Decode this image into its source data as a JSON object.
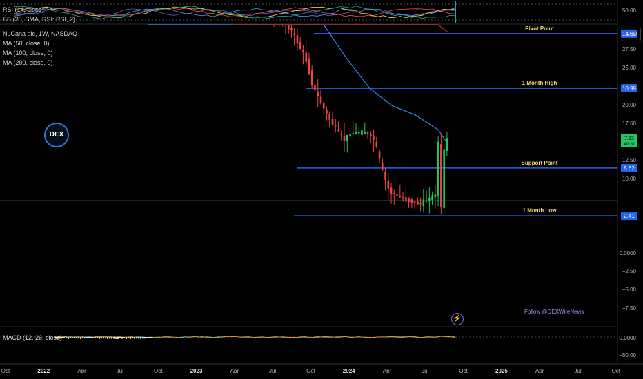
{
  "indicators": {
    "rsi_label": "RSI (14, close)",
    "bb_label": "BB (20, SMA, RSI: RSI, 2)",
    "ma50_label": "MA (50, close, 0)",
    "ma100_label": "MA (100, close, 0)",
    "ma200_label": "MA (200, close, 0)",
    "macd_label": "MACD (12, 26, close)"
  },
  "header": {
    "symbol_title": "NuCana plc, 1W, NASDAQ"
  },
  "currency_button": "USD",
  "logo_text": "DEX",
  "watermark": "Follow @DEXWireNews",
  "colors": {
    "up": "#22c55e",
    "down": "#ef4444",
    "level_line": "#2563eb",
    "ma_blue": "#3b82f6",
    "ma_red": "#dc2626",
    "label_gold": "#f5d76e",
    "current_price_bg": "#22c55e"
  },
  "chart_data": {
    "type": "candlestick",
    "title": "NuCana plc, 1W, NASDAQ",
    "currency": "USD",
    "x_tick_labels": [
      "Oct",
      "2022",
      "Apr",
      "Jul",
      "Oct",
      "2023",
      "Apr",
      "Jul",
      "Oct",
      "2024",
      "Apr",
      "Jul",
      "Oct",
      "2025",
      "Apr",
      "Jul",
      "Oct"
    ],
    "y_tick_labels": [
      "27.50",
      "25.00",
      "22.50",
      "20.00",
      "17.50",
      "12.50",
      "10.00",
      "0.0000",
      "−2.50",
      "−5.00",
      "−7.50"
    ],
    "ylim": [
      -10,
      30
    ],
    "levels": [
      {
        "name": "Pivot Point",
        "value": 14.67,
        "label": "14.67"
      },
      {
        "name": "1 Month High",
        "value": 10.99,
        "label": "10.99"
      },
      {
        "name": "Support Point",
        "value": 5.62,
        "label": "5.62"
      },
      {
        "name": "1 Month Low",
        "value": 2.41,
        "label": "2.41"
      }
    ],
    "current_price": 7.52,
    "current_price_label": "7.53",
    "current_price_sub": "40 20",
    "rsi_axis_label": "50.00",
    "macd_axis_labels": [
      "0.0000",
      "−50.00"
    ],
    "price_path": [
      [
        -1.0,
        27
      ],
      [
        -0.9,
        25
      ],
      [
        -0.8,
        22
      ],
      [
        -0.7,
        20
      ],
      [
        -0.6,
        18
      ],
      [
        -0.5,
        15.5
      ],
      [
        -0.4,
        15
      ],
      [
        -0.3,
        16
      ],
      [
        -0.2,
        18
      ],
      [
        -0.1,
        19
      ],
      [
        0.0,
        22
      ],
      [
        0.1,
        29
      ],
      [
        0.15,
        28
      ],
      [
        0.25,
        24
      ],
      [
        0.35,
        22
      ],
      [
        0.45,
        19
      ],
      [
        0.5,
        18
      ],
      [
        0.55,
        21
      ],
      [
        0.6,
        27
      ],
      [
        0.65,
        30
      ],
      [
        0.7,
        29
      ],
      [
        0.75,
        30
      ],
      [
        0.8,
        28
      ],
      [
        0.9,
        24
      ],
      [
        1.0,
        21
      ],
      [
        1.05,
        22
      ],
      [
        1.1,
        20
      ],
      [
        1.15,
        22
      ],
      [
        1.25,
        21
      ],
      [
        1.35,
        19
      ],
      [
        1.45,
        17
      ],
      [
        1.55,
        16
      ],
      [
        1.65,
        15
      ],
      [
        1.75,
        13
      ],
      [
        1.8,
        11
      ],
      [
        1.9,
        9
      ],
      [
        2.0,
        7.5
      ],
      [
        2.05,
        8
      ],
      [
        2.15,
        8
      ],
      [
        2.2,
        7.5
      ],
      [
        2.25,
        5.5
      ],
      [
        2.3,
        4
      ],
      [
        2.4,
        3.5
      ],
      [
        2.5,
        3.2
      ],
      [
        2.55,
        3.5
      ],
      [
        2.6,
        3.8
      ],
      [
        2.62,
        7.5
      ],
      [
        2.64,
        2.5
      ],
      [
        2.66,
        7.5
      ]
    ],
    "ma_blue_path": [
      [
        0.7,
        24
      ],
      [
        0.85,
        29
      ],
      [
        1.05,
        27.5
      ],
      [
        1.25,
        25
      ],
      [
        1.45,
        23
      ],
      [
        1.65,
        20
      ],
      [
        1.85,
        16
      ],
      [
        2.0,
        13
      ],
      [
        2.15,
        11
      ],
      [
        2.3,
        9.8
      ],
      [
        2.45,
        9.2
      ],
      [
        2.6,
        8.2
      ],
      [
        2.66,
        7.3
      ]
    ],
    "ma_red_path": [
      [
        1.25,
        30
      ],
      [
        1.4,
        27.5
      ],
      [
        1.55,
        24
      ],
      [
        1.7,
        22
      ],
      [
        1.85,
        21
      ],
      [
        2.0,
        20
      ],
      [
        2.15,
        19
      ],
      [
        2.3,
        18.5
      ],
      [
        2.45,
        17
      ],
      [
        2.6,
        15.5
      ],
      [
        2.66,
        14.8
      ]
    ]
  }
}
